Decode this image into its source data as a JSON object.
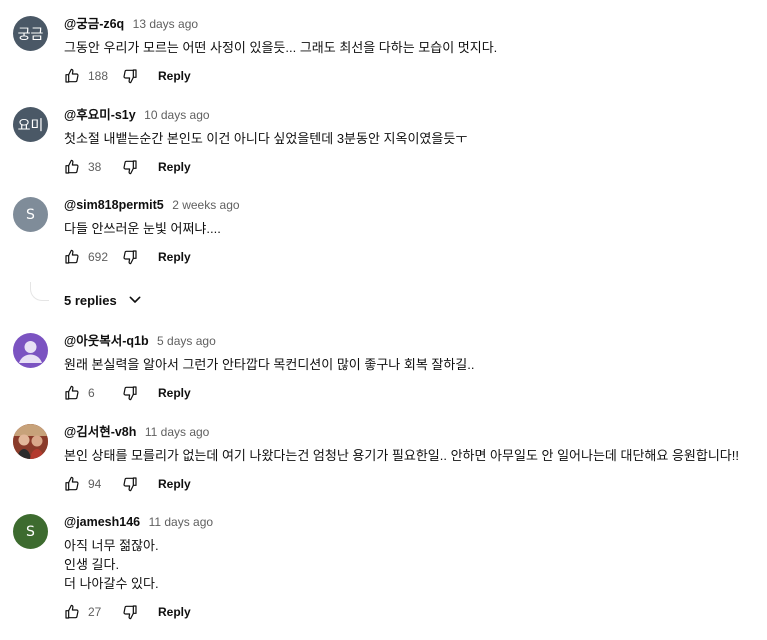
{
  "comments": [
    {
      "author": "@궁금-z6q",
      "time": "13 days ago",
      "avatar_text": "궁금",
      "avatar_color": "#4a5866",
      "text": "그동안 우리가 모르는 어떤 사정이 있을듯... 그래도 최선을 다하는 모습이 멋지다.",
      "likes": "188",
      "reply_label": "Reply"
    },
    {
      "author": "@후요미-s1y",
      "time": "10 days ago",
      "avatar_text": "요미",
      "avatar_color": "#4a5866",
      "text": "첫소절 내뱉는순간 본인도 이건 아니다 싶었을텐데 3분동안 지옥이였을듯ㅜ",
      "likes": "38",
      "reply_label": "Reply"
    },
    {
      "author": "@sim818permit5",
      "time": "2 weeks ago",
      "avatar_text": "S",
      "avatar_color": "#7f8c99",
      "text": "다들 안쓰러운 눈빛 어쩌냐....",
      "likes": "692",
      "reply_label": "Reply",
      "replies_label": "5 replies"
    },
    {
      "author": "@아웃복서-q1b",
      "time": "5 days ago",
      "avatar_icon": "default-user-icon",
      "avatar_color": "#7b53c1",
      "text": "원래 본실력을 알아서 그런가 안타깝다 목컨디션이 많이 좋구나  회복 잘하길..",
      "likes": "6",
      "reply_label": "Reply"
    },
    {
      "author": "@김서현-v8h",
      "time": "11 days ago",
      "avatar_icon": "photo-avatar",
      "avatar_color": "#a0523a",
      "text": "본인 상태를 모를리가 없는데 여기 나왔다는건 엄청난 용기가 필요한일.. 안하면 아무일도 안 일어나는데 대단해요 응원합니다!!",
      "likes": "94",
      "reply_label": "Reply"
    },
    {
      "author": "@jamesh146",
      "time": "11 days ago",
      "avatar_text": "S",
      "avatar_color": "#3d6b2f",
      "text": "아직 너무 젊잖아.\n인생 길다.\n더 나아갈수 있다.",
      "likes": "27",
      "reply_label": "Reply"
    }
  ]
}
